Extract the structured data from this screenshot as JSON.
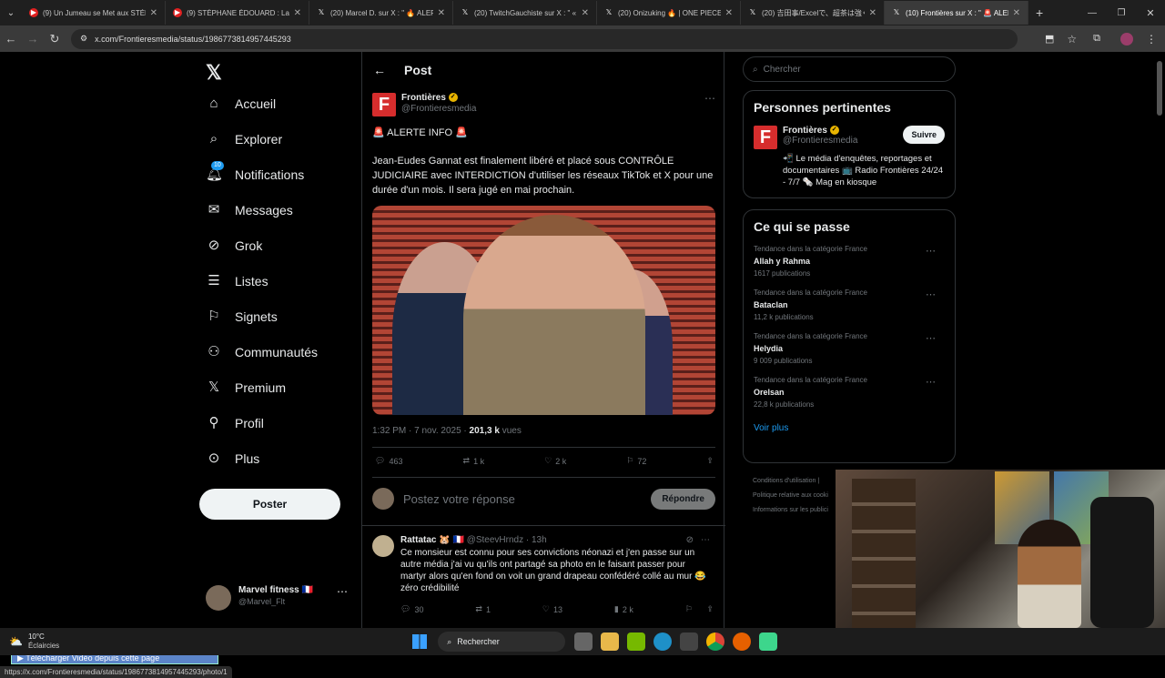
{
  "browser": {
    "tabs": [
      {
        "label": "(9) Un Jumeau se Met aux STÉR",
        "icon": "youtube"
      },
      {
        "label": "(9) STÉPHANE ÉDOUARD : La d",
        "icon": "youtube"
      },
      {
        "label": "(20) Marcel D. sur X : \" 🔥 ALERT",
        "icon": "x"
      },
      {
        "label": "(20) TwitchGauchiste sur X : \" «",
        "icon": "x"
      },
      {
        "label": "(20) Onizuking 🔥 | ONE PIECE",
        "icon": "x"
      },
      {
        "label": "(20) 吉田事/Excelで、超茶は強く",
        "icon": "x"
      },
      {
        "label": "(10) Frontières sur X : \" 🚨 ALERT",
        "icon": "x"
      }
    ],
    "url": "x.com/Frontieresmedia/status/1986773814957445293",
    "status_url": "https://x.com/Frontieresmedia/status/1986773814957445293/photo/1"
  },
  "sidebar": {
    "items": [
      {
        "label": "Accueil"
      },
      {
        "label": "Explorer"
      },
      {
        "label": "Notifications",
        "badge": "10"
      },
      {
        "label": "Messages"
      },
      {
        "label": "Grok"
      },
      {
        "label": "Listes"
      },
      {
        "label": "Signets"
      },
      {
        "label": "Communautés"
      },
      {
        "label": "Premium"
      },
      {
        "label": "Profil"
      },
      {
        "label": "Plus"
      }
    ],
    "post_button": "Poster",
    "account": {
      "name": "Marvel fitness 🇫🇷",
      "handle": "@Marvel_Flt"
    }
  },
  "post": {
    "header": "Post",
    "author": "Frontières",
    "handle": "@Frontieresmedia",
    "alert": "🚨 ALERTE INFO 🚨",
    "text": "Jean-Eudes Gannat est finalement libéré et placé sous CONTRÔLE JUDICIAIRE avec INTERDICTION d'utiliser les réseaux TikTok et X pour une durée d'un mois. Il sera jugé en mai prochain.",
    "time": "1:32 PM · 7 nov. 2025 · ",
    "views": "201,3 k",
    "views_label": " vues",
    "replies": "463",
    "reposts": "1 k",
    "likes": "2 k",
    "bookmarks": "72",
    "reply_placeholder": "Postez votre réponse",
    "reply_button": "Répondre"
  },
  "reply_post": {
    "author": "Rattatac 🐹 🇫🇷",
    "handle": "@SteevHrndz",
    "time": "· 13h",
    "text": "Ce monsieur est connu pour ses convictions néonazi et j'en passe sur un autre média j'ai vu qu'ils ont partagé sa photo en le faisant passer pour martyr alors qu'en fond on voit un grand drapeau confédéré collé au mur 😂 zéro crédibilité",
    "replies": "30",
    "reposts": "1",
    "likes": "13",
    "views": "2 k"
  },
  "right": {
    "search_placeholder": "Chercher",
    "relevant_title": "Personnes pertinentes",
    "relevant": {
      "name": "Frontières",
      "handle": "@Frontieresmedia",
      "follow": "Suivre",
      "bio": "📲 Le média d'enquêtes, reportages et documentaires 📺 Radio Frontières 24/24 - 7/7 🗞️ Mag en kiosque"
    },
    "trends_title": "Ce qui se passe",
    "trends": [
      {
        "category": "Tendance dans la catégorie France",
        "name": "Allah y Rahma",
        "count": "1617 publications"
      },
      {
        "category": "Tendance dans la catégorie France",
        "name": "Bataclan",
        "count": "11,2 k publications"
      },
      {
        "category": "Tendance dans la catégorie France",
        "name": "Helydia",
        "count": "9 009 publications"
      },
      {
        "category": "Tendance dans la catégorie France",
        "name": "Orelsan",
        "count": "22,8 k publications"
      }
    ],
    "see_more": "Voir plus",
    "footer": [
      "Conditions d'utilisation |",
      "Politique relative aux cooki",
      "Informations sur les publici"
    ]
  },
  "extension_bar": "▶ Télécharger Vidéo depuis cette page",
  "taskbar": {
    "weather_temp": "10°C",
    "weather_desc": "Éclaircies",
    "search": "Rechercher"
  },
  "colors": {
    "accent": "#1d9bf0",
    "brand": "#d62d2d"
  }
}
